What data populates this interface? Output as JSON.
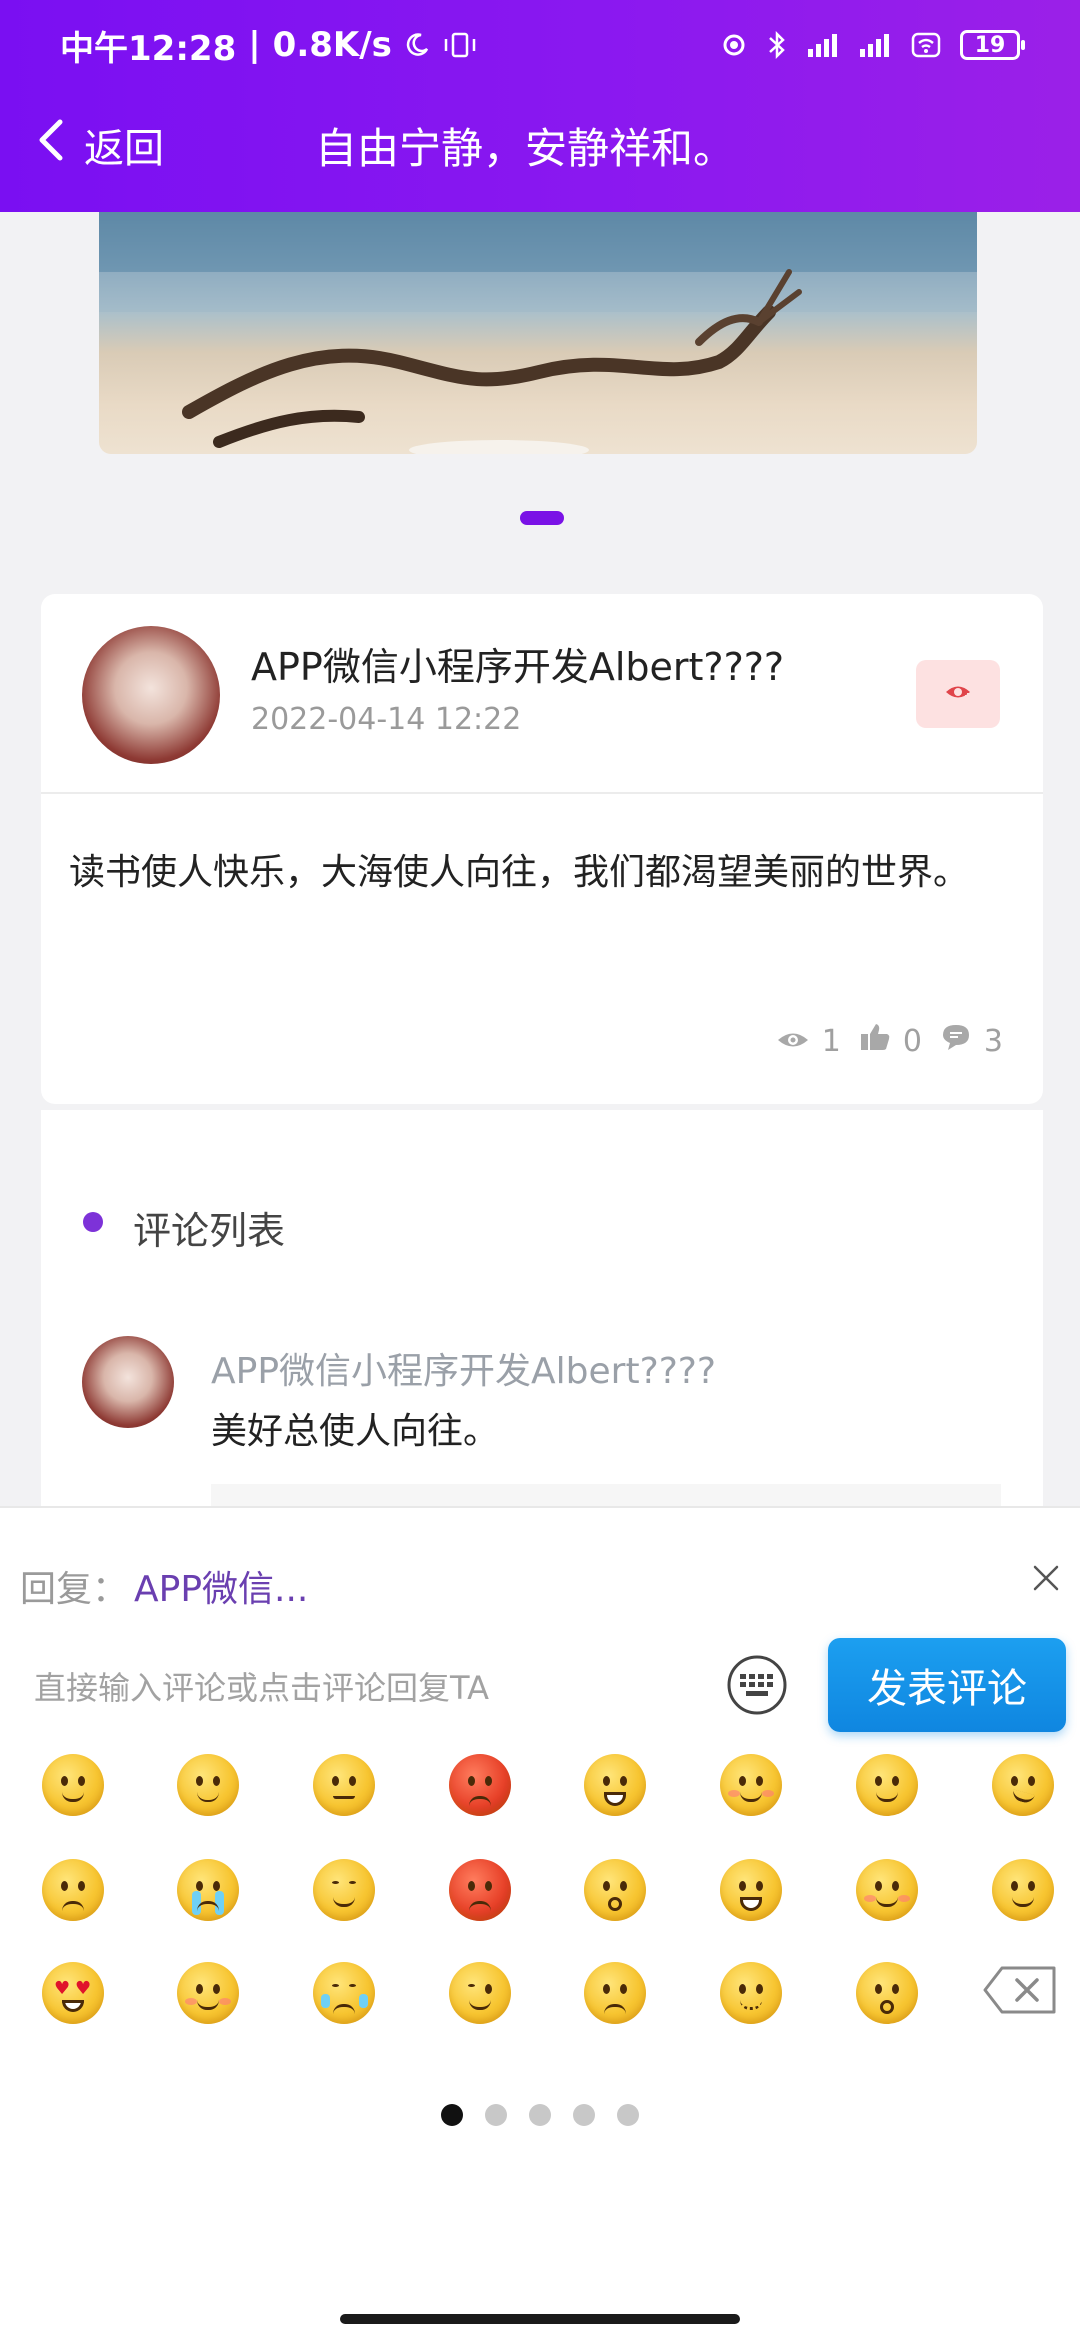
{
  "status_bar": {
    "time": "中午12:28",
    "net_speed": "0.8K/s",
    "battery": "19"
  },
  "nav": {
    "back_label": "返回",
    "title": "自由宁静，安静祥和。"
  },
  "post": {
    "author": "APP微信小程序开发Albert????",
    "time": "2022-04-14 12:22",
    "content": "读书使人快乐，大海使人向往，我们都渴望美丽的世界。",
    "views": "1",
    "likes": "0",
    "comments": "3"
  },
  "comments_section": {
    "title": "评论列表",
    "items": [
      {
        "author": "APP微信小程序开发Albert????",
        "text": "美好总使人向往。"
      }
    ]
  },
  "reply_panel": {
    "label": "回复：",
    "target": "APP微信...",
    "input_placeholder": "直接输入评论或点击评论回复TA",
    "input_value": "",
    "submit_label": "发表评论",
    "emoji_page_count": 5,
    "emoji_page_active": 1
  },
  "colors": {
    "header_gradient_start": "#7a0ff2",
    "header_gradient_end": "#9b20e8",
    "accent_purple": "#6a3fb0",
    "submit_blue": "#0f86e0",
    "follow_bg": "#fde1e1",
    "follow_icon": "#e0444a"
  },
  "icons": {
    "back": "chevron-left-icon",
    "follow": "follow-icon",
    "views": "eye-icon",
    "likes": "thumbs-up-icon",
    "comments": "comment-bubble-icon",
    "close": "close-icon",
    "keyboard": "keyboard-icon",
    "delete": "backspace-icon"
  }
}
